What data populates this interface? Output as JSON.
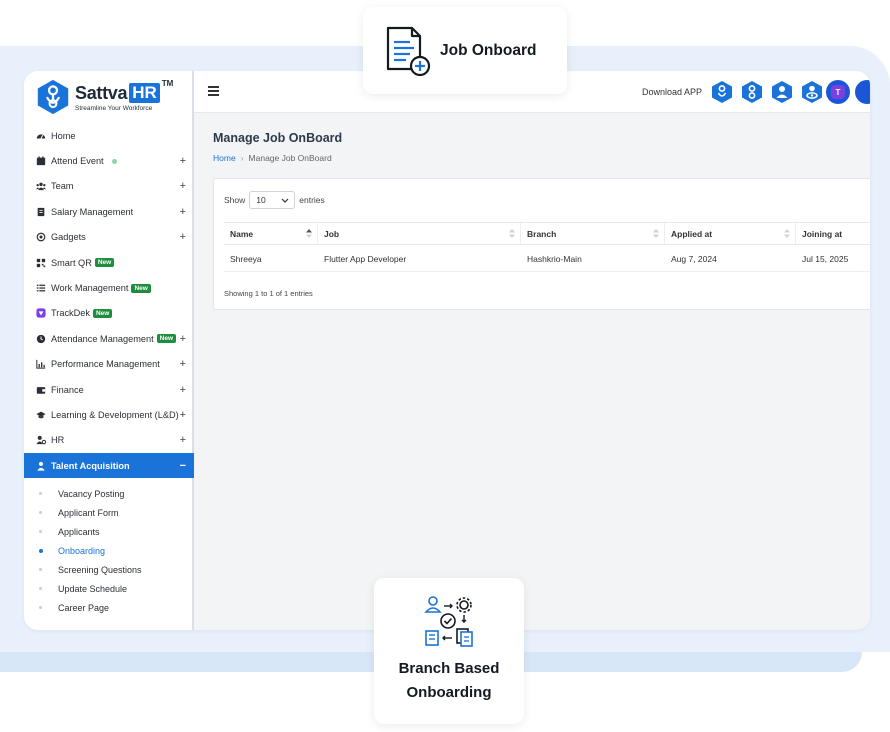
{
  "brand": {
    "name": "Sattva",
    "name_hr": "HR",
    "tm": "TM",
    "tagline": "Streamline Your Workforce",
    "accent": "#1a73d9"
  },
  "sidebar": {
    "items": [
      {
        "label": "Home",
        "icon": "dashboard-icon",
        "expandable": false
      },
      {
        "label": "Attend Event",
        "icon": "calendar-icon",
        "expandable": true,
        "status_dot": true
      },
      {
        "label": "Team",
        "icon": "team-icon",
        "expandable": true
      },
      {
        "label": "Salary Management",
        "icon": "ledger-icon",
        "expandable": true
      },
      {
        "label": "Gadgets",
        "icon": "gadget-icon",
        "expandable": true
      },
      {
        "label": "Smart QR",
        "icon": "qr-icon",
        "expandable": false,
        "badge": "New"
      },
      {
        "label": "Work Management",
        "icon": "list-icon",
        "expandable": false,
        "badge": "New"
      },
      {
        "label": "TrackDek",
        "icon": "trackdek-icon",
        "expandable": false,
        "badge": "New"
      },
      {
        "label": "Attendance Management",
        "icon": "clock-icon",
        "expandable": true,
        "badge": "New"
      },
      {
        "label": "Performance Management",
        "icon": "chart-icon",
        "expandable": true
      },
      {
        "label": "Finance",
        "icon": "wallet-icon",
        "expandable": true
      },
      {
        "label": "Learning & Development (L&D)",
        "icon": "graduation-cap-icon",
        "expandable": true
      },
      {
        "label": "HR",
        "icon": "user-gear-icon",
        "expandable": true
      },
      {
        "label": "Talent Acquisition",
        "icon": "user-icon",
        "expandable": true,
        "active": true
      }
    ],
    "plus_symbol": "+",
    "minus_symbol": "−",
    "submenu": [
      {
        "label": "Vacancy Posting"
      },
      {
        "label": "Applicant Form"
      },
      {
        "label": "Applicants"
      },
      {
        "label": "Onboarding",
        "current": true
      },
      {
        "label": "Screening Questions"
      },
      {
        "label": "Update Schedule"
      },
      {
        "label": "Career Page"
      }
    ]
  },
  "topbar": {
    "download_label": "Download APP",
    "app_icons": [
      "android-app-icon",
      "ios-app-icon",
      "face-app-icon",
      "eye-app-icon"
    ],
    "avatar_letter": "T"
  },
  "page": {
    "title": "Manage Job OnBoard",
    "breadcrumb_home": "Home",
    "breadcrumb_sep": "›",
    "breadcrumb_current": "Manage Job OnBoard"
  },
  "table": {
    "show_label": "Show",
    "entries_value": "10",
    "entries_label": "entries",
    "columns": [
      "Name",
      "Job",
      "Branch",
      "Applied at",
      "Joining at"
    ],
    "rows": [
      [
        "Shreeya",
        "Flutter App Developer",
        "Hashkrio-Main",
        "Aug 7, 2024",
        "Jul 15, 2025"
      ]
    ],
    "info": "Showing 1 to 1 of 1 entries"
  },
  "callouts": {
    "top": "Job Onboard",
    "bottom_line1": "Branch Based",
    "bottom_line2": "Onboarding"
  }
}
